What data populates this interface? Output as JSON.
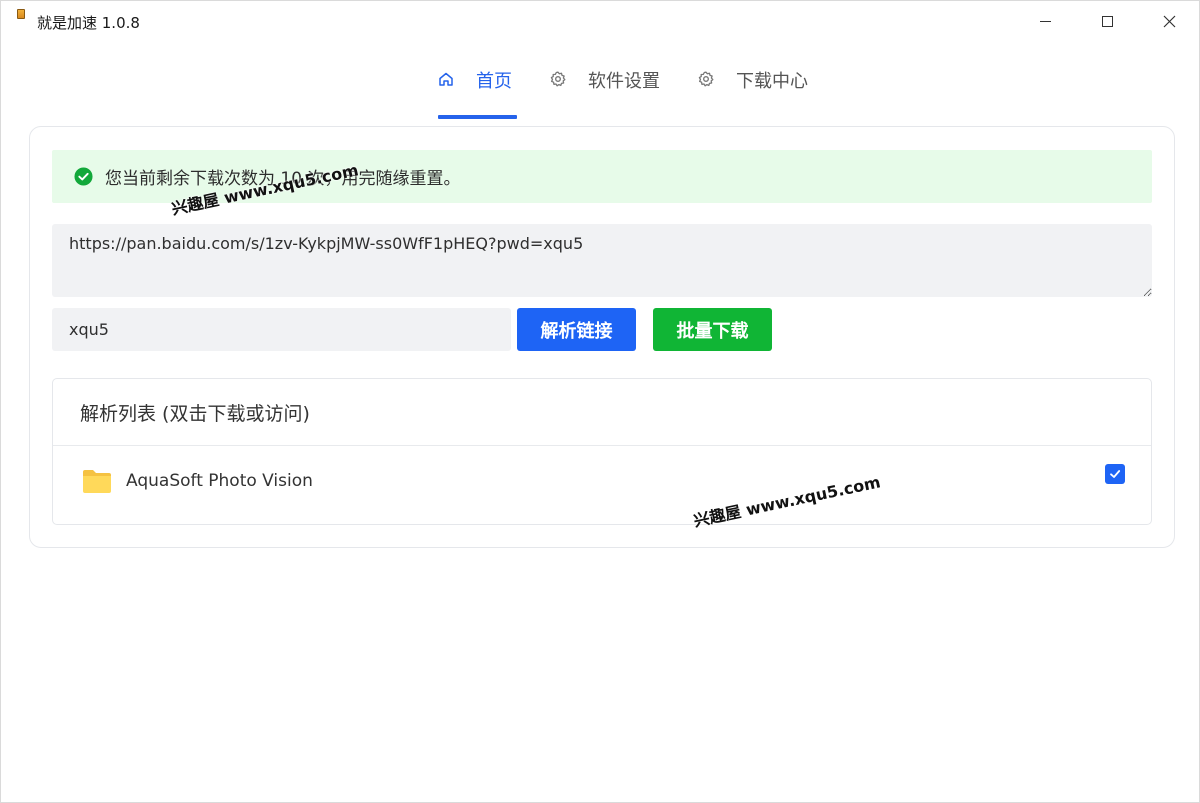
{
  "window": {
    "title": "就是加速  1.0.8"
  },
  "tabs": [
    {
      "label": "首页",
      "icon": "home-icon",
      "active": true
    },
    {
      "label": "软件设置",
      "icon": "gear-icon",
      "active": false
    },
    {
      "label": "下载中心",
      "icon": "gear-icon",
      "active": false
    }
  ],
  "alert": {
    "text": "您当前剩余下载次数为 10 次，用完随缘重置。"
  },
  "form": {
    "url_value": "https://pan.baidu.com/s/1zv-KykpjMW-ss0WfF1pHEQ?pwd=xqu5",
    "password_value": "xqu5",
    "parse_label": "解析链接",
    "batch_label": "批量下载"
  },
  "list": {
    "title": "解析列表 (双击下载或访问)",
    "items": [
      {
        "name": "AquaSoft Photo Vision",
        "checked": true
      }
    ]
  },
  "watermarks": {
    "text1": "兴趣屋 www.xqu5.com",
    "text2": "兴趣屋 www.xqu5.com"
  },
  "colors": {
    "primary": "#1e64f5",
    "success": "#10b535",
    "alert_bg": "#e7fbe9"
  }
}
